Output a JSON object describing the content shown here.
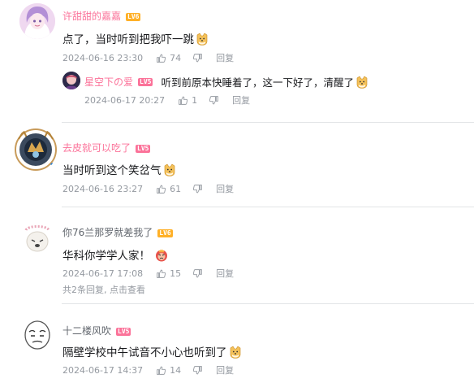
{
  "comments": [
    {
      "username": "许甜甜的嘉嘉",
      "level": "LV6",
      "text": "点了，当时听到把我吓一跳",
      "date": "2024-06-16 23:30",
      "likes": "74",
      "reply_label": "回复",
      "replies": [
        {
          "username": "星空下の爱",
          "level": "LV5",
          "text": "听到前原本快睡着了，这一下好了，清醒了",
          "date": "2024-06-17 20:27",
          "likes": "1",
          "reply_label": "回复"
        }
      ]
    },
    {
      "username": "去皮就可以吃了",
      "level": "LV5",
      "text": "当时听到这个笑岔气",
      "date": "2024-06-16 23:27",
      "likes": "61",
      "reply_label": "回复"
    },
    {
      "username": "你76兰那罗就差我了",
      "level": "LV6",
      "text": "华科你学学人家！",
      "date": "2024-06-17 17:08",
      "likes": "15",
      "reply_label": "回复",
      "more_replies": "共2条回复, 点击查看"
    },
    {
      "username": "十二楼风吹",
      "level": "LV5",
      "text": "隔壁学校中午试音不小心也听到了",
      "date": "2024-06-17 14:37",
      "likes": "14",
      "reply_label": "回复"
    }
  ],
  "colors": {
    "username_pink": "#fb7299",
    "username_gray": "#61666d",
    "meta_gray": "#9499a0",
    "divider": "#e3e5e7"
  },
  "icons": [
    "thumb-up-icon",
    "thumb-down-icon",
    "doge-emoji-icon",
    "angry-emoji-icon"
  ]
}
